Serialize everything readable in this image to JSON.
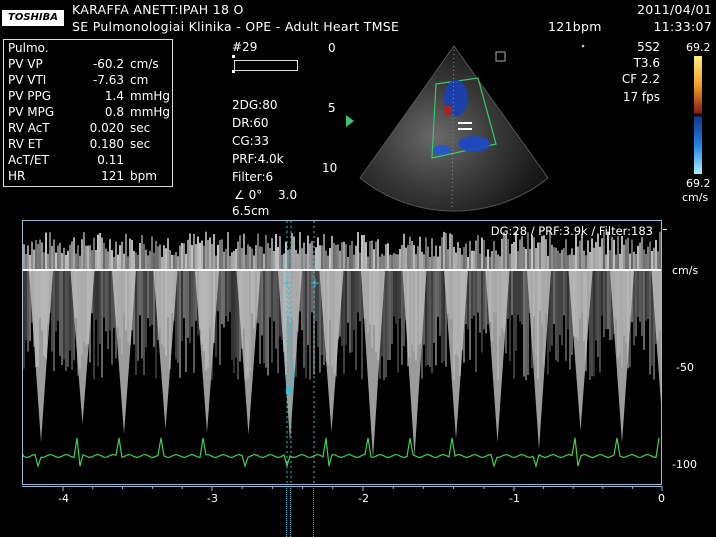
{
  "header": {
    "brand": "TOSHIBA",
    "patient": "KARAFFA ANETT:IPAH     18   O",
    "institution": "SE Pulmonologiai Klinika   - OPE -    Adult Heart TMSE",
    "heart_rate": "121bpm",
    "date": "2011/04/01",
    "time": "11:33:07"
  },
  "measurements": {
    "title": "Pulmo.",
    "rows": [
      {
        "label": "PV VP",
        "value": "-60.2",
        "unit": "cm/s"
      },
      {
        "label": "PV VTI",
        "value": "-7.63",
        "unit": "cm"
      },
      {
        "label": "PV PPG",
        "value": "1.4",
        "unit": "mmHg"
      },
      {
        "label": "PV MPG",
        "value": "0.8",
        "unit": "mmHg"
      },
      {
        "label": "RV AcT",
        "value": "0.020",
        "unit": "sec"
      },
      {
        "label": "RV ET",
        "value": "0.180",
        "unit": "sec"
      },
      {
        "label": "AcT/ET",
        "value": "0.11",
        "unit": ""
      },
      {
        "label": "HR",
        "value": "121",
        "unit": "bpm"
      }
    ]
  },
  "frame_number": "#29",
  "settings": {
    "2dg": "2DG:80",
    "dr": "DR:60",
    "cg": "CG:33",
    "prf": "PRF:4.0k",
    "filter": "Filter:6",
    "angle": "∠ 0°",
    "angle_value": "3.0",
    "depth": "6.5cm"
  },
  "depth_scale": {
    "d0": "0",
    "d5": "5",
    "d10": "10"
  },
  "probe": {
    "model": "5S2",
    "freq": "T3.6",
    "cf": "CF 2.2",
    "fps": "17 fps"
  },
  "color_bar": {
    "top_value": "69.2",
    "bottom_value": "69.2",
    "unit": "cm/s",
    "top_color": "#ffd700",
    "bottom_color": "#00bfff"
  },
  "doppler": {
    "settings_text": "DG:28 /   PRF:3.9k   / Filter:183",
    "velocity_unit": "cm/s",
    "velocity_ticks": [
      "-50",
      "-100"
    ],
    "time_ticks": [
      "-4",
      "-3",
      "-2",
      "-1",
      "0"
    ],
    "ecg_color": "#3fd14a",
    "cursor_color": "#33c3d6"
  }
}
